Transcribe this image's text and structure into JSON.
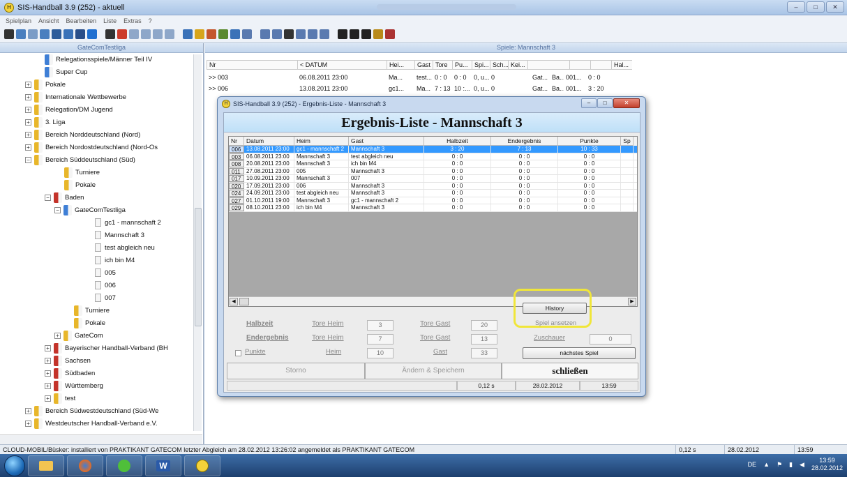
{
  "app": {
    "title": "SIS-Handball 3.9 (252) - aktuell",
    "menu": [
      "Spielplan",
      "Ansicht",
      "Bearbeiten",
      "Liste",
      "Extras",
      "?"
    ]
  },
  "tree": {
    "header": "GateComTestliga",
    "nodes": [
      {
        "label": "Relegationsspiele/Männer Teil IV",
        "indent": 64,
        "icon": "blue",
        "plus": false
      },
      {
        "label": "Super Cup",
        "indent": 64,
        "icon": "blue",
        "plus": false
      },
      {
        "label": "Pokale",
        "indent": 50,
        "icon": "yellow",
        "plus": true
      },
      {
        "label": "Internationale Wettbewerbe",
        "indent": 50,
        "icon": "yellow",
        "plus": true
      },
      {
        "label": "Relegation/DM Jugend",
        "indent": 50,
        "icon": "yellow",
        "plus": true
      },
      {
        "label": "3. Liga",
        "indent": 50,
        "icon": "yellow",
        "plus": true
      },
      {
        "label": "Bereich Norddeutschland (Nord)",
        "indent": 50,
        "icon": "yellow",
        "plus": true
      },
      {
        "label": "Bereich Nordostdeutschland (Nord-Os",
        "indent": 50,
        "icon": "yellow",
        "plus": true
      },
      {
        "label": "Bereich Süddeutschland (Süd)",
        "indent": 50,
        "icon": "yellow",
        "plus": true
      },
      {
        "label": "Turniere",
        "indent": 92,
        "icon": "yellow",
        "plus": false
      },
      {
        "label": "Pokale",
        "indent": 92,
        "icon": "yellow",
        "plus": false
      },
      {
        "label": "Baden",
        "indent": 78,
        "icon": "red",
        "plus": true
      },
      {
        "label": "GateComTestliga",
        "indent": 92,
        "icon": "blue",
        "plus": true
      },
      {
        "label": "gc1 - mannschaft 2",
        "indent": 136,
        "icon": "doc",
        "plus": false
      },
      {
        "label": "Mannschaft 3",
        "indent": 136,
        "icon": "doc",
        "plus": false
      },
      {
        "label": "test abgleich neu",
        "indent": 136,
        "icon": "doc",
        "plus": false
      },
      {
        "label": "ich bin M4",
        "indent": 136,
        "icon": "doc",
        "plus": false
      },
      {
        "label": "005",
        "indent": 136,
        "icon": "doc",
        "plus": false
      },
      {
        "label": "006",
        "indent": 136,
        "icon": "doc",
        "plus": false
      },
      {
        "label": "007",
        "indent": 136,
        "icon": "doc",
        "plus": false
      },
      {
        "label": "Turniere",
        "indent": 106,
        "icon": "yellow",
        "plus": false
      },
      {
        "label": "Pokale",
        "indent": 106,
        "icon": "yellow",
        "plus": false
      },
      {
        "label": "GateCom",
        "indent": 92,
        "icon": "yellow",
        "plus": true
      },
      {
        "label": "Bayerischer Handball-Verband (BH",
        "indent": 78,
        "icon": "red",
        "plus": true
      },
      {
        "label": "Sachsen",
        "indent": 78,
        "icon": "red",
        "plus": true
      },
      {
        "label": "Südbaden",
        "indent": 78,
        "icon": "red",
        "plus": true
      },
      {
        "label": "Württemberg",
        "indent": 78,
        "icon": "red",
        "plus": true
      },
      {
        "label": "test",
        "indent": 78,
        "icon": "yellow",
        "plus": true
      },
      {
        "label": "Bereich Südwestdeutschland (Süd-We",
        "indent": 50,
        "icon": "yellow",
        "plus": true
      },
      {
        "label": "Westdeutscher Handball-Verband e.V.",
        "indent": 50,
        "icon": "yellow",
        "plus": true
      }
    ]
  },
  "games": {
    "header": "Spiele: Mannschaft 3",
    "columns": [
      "Nr",
      "< DATUM",
      "Hei...",
      "Gast",
      "Tore",
      "Pu...",
      "Spi...",
      "Sch...",
      "Kei...",
      "",
      "",
      "",
      "Hal..."
    ],
    "rows": [
      {
        "nr": ">> 003",
        "datum": "06.08.2011 23:00",
        "heim": "Ma...",
        "gast": "test...",
        "tore": "0 : 0",
        "pu": "0 : 0",
        "spi": "0, u... 0",
        "x1": "Gat...",
        "x2": "Ba...",
        "x3": "001...",
        "hal": "0 : 0"
      },
      {
        "nr": ">> 006",
        "datum": "13.08.2011 23:00",
        "heim": "gc1...",
        "gast": "Ma...",
        "tore": "7 : 13",
        "pu": "10 :...",
        "spi": "0, u... 0",
        "x1": "Gat...",
        "x2": "Ba...",
        "x3": "001...",
        "hal": "3 : 20"
      }
    ]
  },
  "dialog": {
    "title": "SIS-Handball 3.9 (252) - Ergebnis-Liste - Mannschaft 3",
    "heading": "Ergebnis-Liste - Mannschaft 3",
    "columns": [
      "Nr",
      "Datum",
      "Heim",
      "Gast",
      "Halbzeit",
      "Endergebnis",
      "Punkte",
      "Sp"
    ],
    "rows": [
      {
        "nr": "006",
        "datum": "13.08.2011 23:00",
        "heim": "gc1 - mannschaft 2",
        "gast": "Mannschaft 3",
        "halb": "3 : 20",
        "end": "7 : 13",
        "punkte": "10 : 33",
        "selected": true
      },
      {
        "nr": "003",
        "datum": "06.08.2011 23:00",
        "heim": "Mannschaft 3",
        "gast": "test abgleich neu",
        "halb": "0 : 0",
        "end": "0 : 0",
        "punkte": "0 : 0",
        "selected": false
      },
      {
        "nr": "008",
        "datum": "20.08.2011 23:00",
        "heim": "Mannschaft 3",
        "gast": "ich bin M4",
        "halb": "0 : 0",
        "end": "0 : 0",
        "punkte": "0 : 0",
        "selected": false
      },
      {
        "nr": "011",
        "datum": "27.08.2011 23:00",
        "heim": "005",
        "gast": "Mannschaft 3",
        "halb": "0 : 0",
        "end": "0 : 0",
        "punkte": "0 : 0",
        "selected": false
      },
      {
        "nr": "017",
        "datum": "10.09.2011 23:00",
        "heim": "Mannschaft 3",
        "gast": "007",
        "halb": "0 : 0",
        "end": "0 : 0",
        "punkte": "0 : 0",
        "selected": false
      },
      {
        "nr": "020",
        "datum": "17.09.2011 23:00",
        "heim": "006",
        "gast": "Mannschaft 3",
        "halb": "0 : 0",
        "end": "0 : 0",
        "punkte": "0 : 0",
        "selected": false
      },
      {
        "nr": "024",
        "datum": "24.09.2011 23:00",
        "heim": "test abgleich neu",
        "gast": "Mannschaft 3",
        "halb": "0 : 0",
        "end": "0 : 0",
        "punkte": "0 : 0",
        "selected": false
      },
      {
        "nr": "027",
        "datum": "01.10.2011 19:00",
        "heim": "Mannschaft 3",
        "gast": "gc1 - mannschaft 2",
        "halb": "0 : 0",
        "end": "0 : 0",
        "punkte": "0 : 0",
        "selected": false
      },
      {
        "nr": "029",
        "datum": "08.10.2011 23:00",
        "heim": "ich bin M4",
        "gast": "Mannschaft 3",
        "halb": "0 : 0",
        "end": "0 : 0",
        "punkte": "0 : 0",
        "selected": false
      }
    ],
    "history_label": "History",
    "spiel_ansetzen_label": "Spiel ansetzen",
    "halbzeit_label": "Halbzeit",
    "endergebnis_label": "Endergebnis",
    "punkte_label": "Punkte",
    "tore_heim_label": "Tore Heim",
    "tore_gast_label": "Tore Gast",
    "heim_label": "Heim",
    "gast_label": "Gast",
    "zuschauer_label": "Zuschauer",
    "halbzeit_heim": "3",
    "halbzeit_gast": "20",
    "end_heim": "7",
    "end_gast": "13",
    "punkte_heim": "10",
    "punkte_gast": "33",
    "zuschauer_value": "0",
    "next_game_label": "nächstes Spiel",
    "storno_label": "Storno",
    "aendern_label": "Ändern & Speichern",
    "schliessen_label": "schließen",
    "status_time": "0,12 s",
    "status_date": "28.02.2012",
    "status_clock": "13:59"
  },
  "status": {
    "message": "CLOUD-MOBIL/Büsker: installiert von PRAKTIKANT GATECOM letzter Abgleich am 28.02.2012 13:26:02 angemeldet als PRAKTIKANT GATECOM",
    "time": "0,12 s",
    "date": "28.02.2012",
    "clock": "13:59"
  },
  "taskbar": {
    "word_label": "W",
    "lang": "DE",
    "clock_time": "13:59",
    "clock_date": "28.02.2012"
  },
  "colors": {
    "selection": "#3399ff",
    "highlight": "#f0e63a",
    "heading_bg": "#bfe0f8"
  }
}
